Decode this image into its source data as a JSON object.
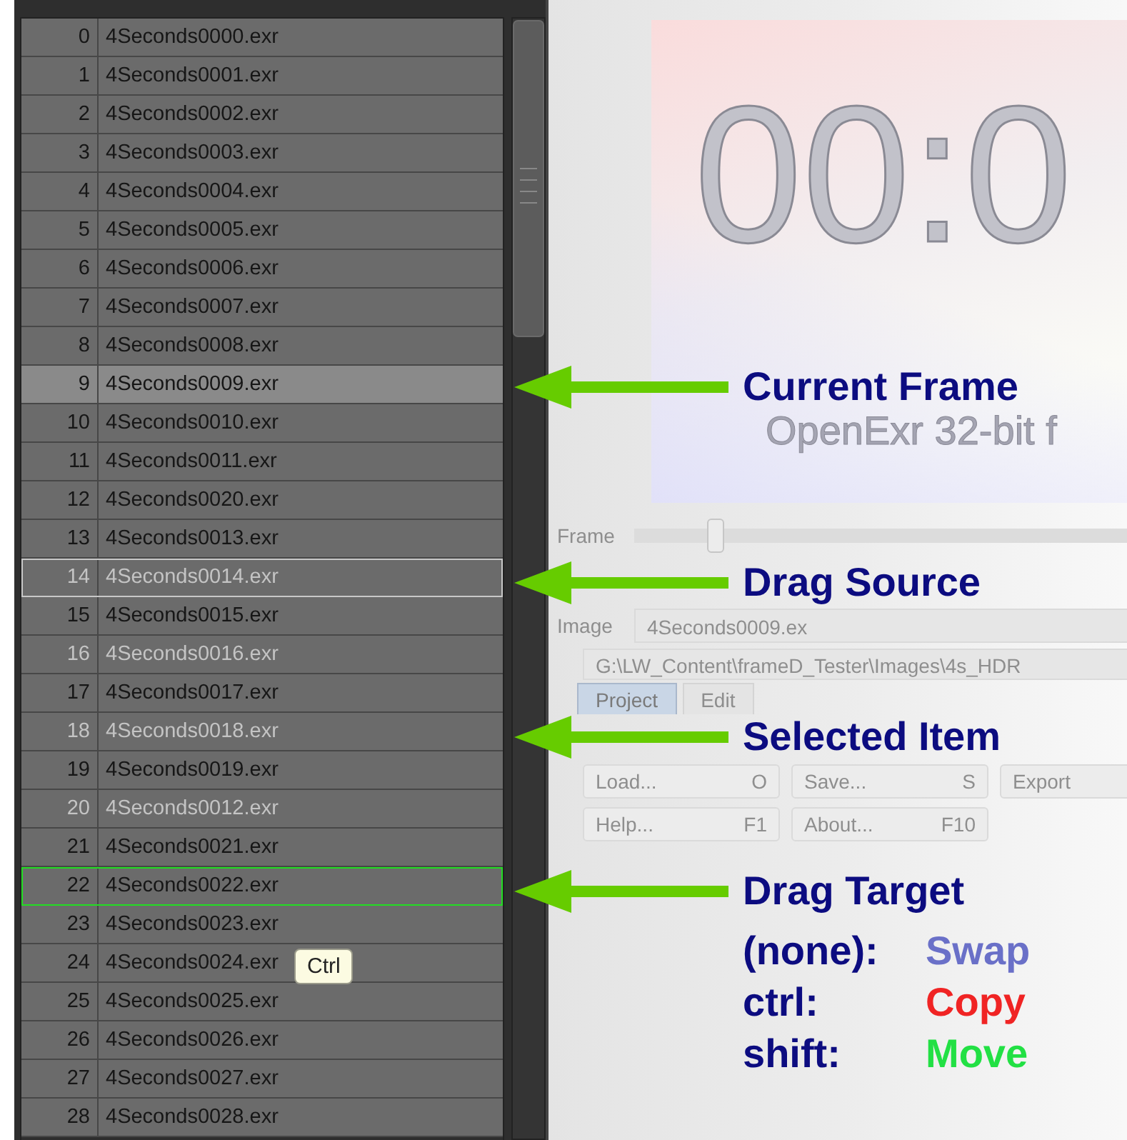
{
  "file_list": {
    "rows": [
      {
        "index": "0",
        "name": "4Seconds0000.exr",
        "current": false,
        "selected": false,
        "drag_source": false,
        "drag_target": false
      },
      {
        "index": "1",
        "name": "4Seconds0001.exr",
        "current": false,
        "selected": false,
        "drag_source": false,
        "drag_target": false
      },
      {
        "index": "2",
        "name": "4Seconds0002.exr",
        "current": false,
        "selected": false,
        "drag_source": false,
        "drag_target": false
      },
      {
        "index": "3",
        "name": "4Seconds0003.exr",
        "current": false,
        "selected": false,
        "drag_source": false,
        "drag_target": false
      },
      {
        "index": "4",
        "name": "4Seconds0004.exr",
        "current": false,
        "selected": false,
        "drag_source": false,
        "drag_target": false
      },
      {
        "index": "5",
        "name": "4Seconds0005.exr",
        "current": false,
        "selected": false,
        "drag_source": false,
        "drag_target": false
      },
      {
        "index": "6",
        "name": "4Seconds0006.exr",
        "current": false,
        "selected": false,
        "drag_source": false,
        "drag_target": false
      },
      {
        "index": "7",
        "name": "4Seconds0007.exr",
        "current": false,
        "selected": false,
        "drag_source": false,
        "drag_target": false
      },
      {
        "index": "8",
        "name": "4Seconds0008.exr",
        "current": false,
        "selected": false,
        "drag_source": false,
        "drag_target": false
      },
      {
        "index": "9",
        "name": "4Seconds0009.exr",
        "current": true,
        "selected": false,
        "drag_source": false,
        "drag_target": false
      },
      {
        "index": "10",
        "name": "4Seconds0010.exr",
        "current": false,
        "selected": false,
        "drag_source": false,
        "drag_target": false
      },
      {
        "index": "11",
        "name": "4Seconds0011.exr",
        "current": false,
        "selected": false,
        "drag_source": false,
        "drag_target": false
      },
      {
        "index": "12",
        "name": "4Seconds0020.exr",
        "current": false,
        "selected": false,
        "drag_source": false,
        "drag_target": false
      },
      {
        "index": "13",
        "name": "4Seconds0013.exr",
        "current": false,
        "selected": false,
        "drag_source": false,
        "drag_target": false
      },
      {
        "index": "14",
        "name": "4Seconds0014.exr",
        "current": false,
        "selected": true,
        "drag_source": true,
        "drag_target": false
      },
      {
        "index": "15",
        "name": "4Seconds0015.exr",
        "current": false,
        "selected": false,
        "drag_source": false,
        "drag_target": false
      },
      {
        "index": "16",
        "name": "4Seconds0016.exr",
        "current": false,
        "selected": true,
        "drag_source": false,
        "drag_target": false
      },
      {
        "index": "17",
        "name": "4Seconds0017.exr",
        "current": false,
        "selected": false,
        "drag_source": false,
        "drag_target": false
      },
      {
        "index": "18",
        "name": "4Seconds0018.exr",
        "current": false,
        "selected": true,
        "drag_source": false,
        "drag_target": false
      },
      {
        "index": "19",
        "name": "4Seconds0019.exr",
        "current": false,
        "selected": false,
        "drag_source": false,
        "drag_target": false
      },
      {
        "index": "20",
        "name": "4Seconds0012.exr",
        "current": false,
        "selected": true,
        "drag_source": false,
        "drag_target": false
      },
      {
        "index": "21",
        "name": "4Seconds0021.exr",
        "current": false,
        "selected": false,
        "drag_source": false,
        "drag_target": false
      },
      {
        "index": "22",
        "name": "4Seconds0022.exr",
        "current": false,
        "selected": false,
        "drag_source": false,
        "drag_target": true
      },
      {
        "index": "23",
        "name": "4Seconds0023.exr",
        "current": false,
        "selected": false,
        "drag_source": false,
        "drag_target": false
      },
      {
        "index": "24",
        "name": "4Seconds0024.exr",
        "current": false,
        "selected": false,
        "drag_source": false,
        "drag_target": false
      },
      {
        "index": "25",
        "name": "4Seconds0025.exr",
        "current": false,
        "selected": false,
        "drag_source": false,
        "drag_target": false
      },
      {
        "index": "26",
        "name": "4Seconds0026.exr",
        "current": false,
        "selected": false,
        "drag_source": false,
        "drag_target": false
      },
      {
        "index": "27",
        "name": "4Seconds0027.exr",
        "current": false,
        "selected": false,
        "drag_source": false,
        "drag_target": false
      },
      {
        "index": "28",
        "name": "4Seconds0028.exr",
        "current": false,
        "selected": false,
        "drag_source": false,
        "drag_target": false
      }
    ]
  },
  "tooltip": {
    "text": "Ctrl"
  },
  "preview": {
    "timecode": "00:0",
    "format": "OpenExr 32-bit f"
  },
  "controls": {
    "frame_label": "Frame",
    "frame_slider": {
      "level": 0.13
    },
    "image_label": "Image",
    "image_value": "4Seconds0009.ex",
    "path": "G:\\LW_Content\\frameD_Tester\\Images\\4s_HDR",
    "tabs": [
      {
        "label": "Project",
        "selected": true
      },
      {
        "label": "Edit",
        "selected": false
      }
    ],
    "button_rows": [
      [
        {
          "label": "Load...",
          "shortcut": "O"
        },
        {
          "label": "Save...",
          "shortcut": "S"
        },
        {
          "label": "Export"
        }
      ],
      [
        {
          "label": "Help...",
          "shortcut": "F1"
        },
        {
          "label": "About...",
          "shortcut": "F10"
        }
      ]
    ]
  },
  "annotations": [
    {
      "label": "Current Frame"
    },
    {
      "label": "Drag Source"
    },
    {
      "label": "Selected Item"
    },
    {
      "label": "Drag Target"
    }
  ],
  "legend": [
    {
      "modifier": "(none):",
      "action": "Swap",
      "color": "#6a70c8"
    },
    {
      "modifier": "ctrl:",
      "action": "Copy",
      "color": "#f02424"
    },
    {
      "modifier": "shift:",
      "action": "Move",
      "color": "#22e044"
    }
  ]
}
